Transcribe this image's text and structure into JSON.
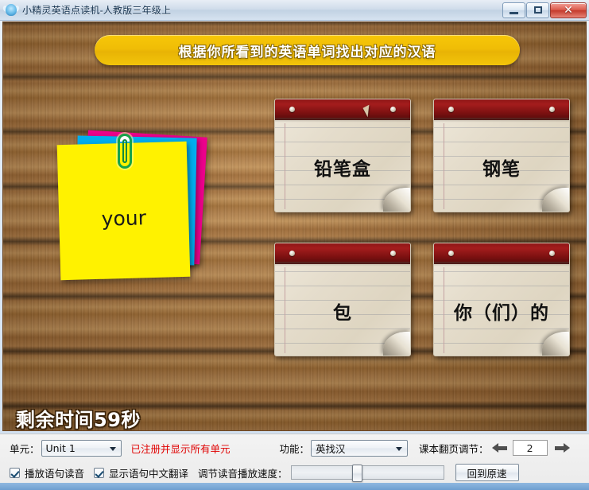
{
  "window": {
    "title": "小精灵英语点读机-人教版三年级上",
    "icon": "fairy-icon",
    "controls": {
      "minimize": "–",
      "maximize": "□",
      "close": "✕"
    }
  },
  "banner": {
    "instruction": "根据你所看到的英语单词找出对应的汉语"
  },
  "prompt": {
    "word": "your"
  },
  "cards": [
    {
      "label": "铅笔盒"
    },
    {
      "label": "钢笔"
    },
    {
      "label": "包"
    },
    {
      "label": "你（们）的"
    }
  ],
  "timer": {
    "text": "剩余时间59秒"
  },
  "panel": {
    "unit_label": "单元：",
    "unit_value": "Unit 1",
    "registration_note": "已注册并显示所有单元",
    "function_label": "功能：",
    "function_value": "英找汉",
    "page_label": "课本翻页调节：",
    "page_value": "2",
    "prev_icon": "arrow-left-icon",
    "next_icon": "arrow-right-icon",
    "checkbox_play_audio": "播放语句读音",
    "checkbox_show_translation": "显示语句中文翻译",
    "speed_label": "调节读音播放速度：",
    "reset_speed_button": "回到原速"
  },
  "colors": {
    "banner": "#f0bd06",
    "note_yellow": "#fff200",
    "note_cyan": "#00adef",
    "note_magenta": "#ec008c",
    "card_header": "#8f1616",
    "registration_note": "#e00000"
  }
}
